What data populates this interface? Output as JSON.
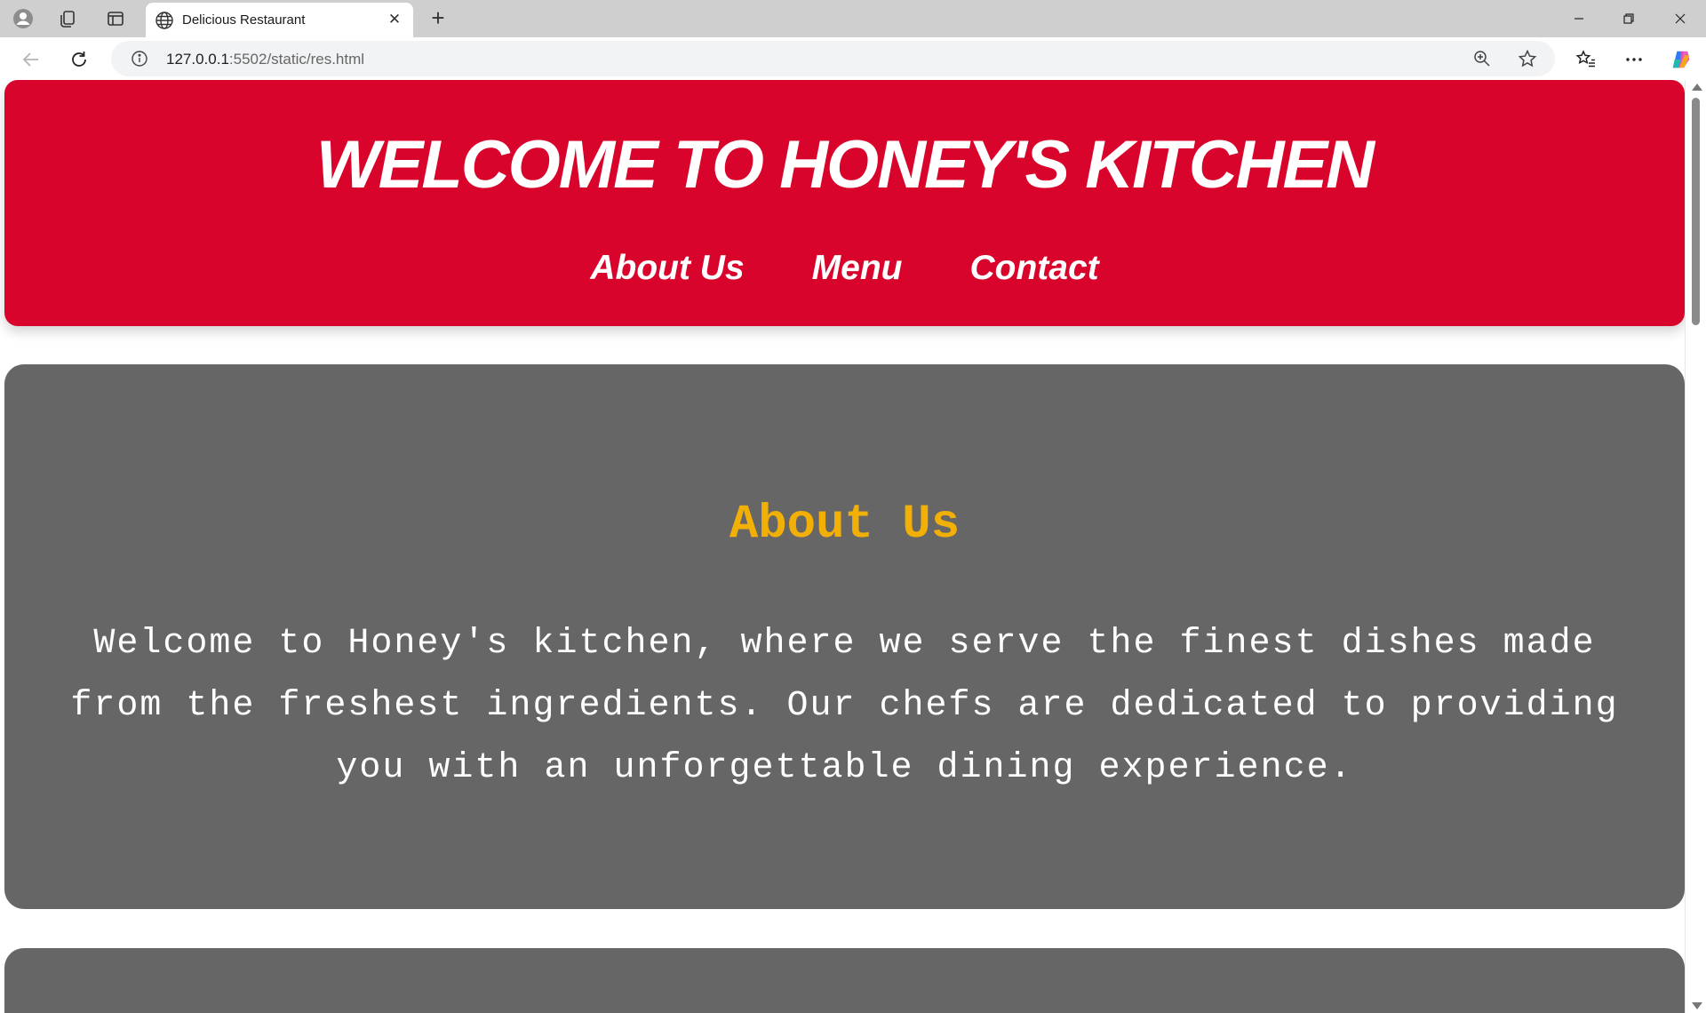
{
  "browser": {
    "tab": {
      "title": "Delicious Restaurant"
    },
    "url": {
      "host": "127.0.0.1",
      "rest": ":5502/static/res.html"
    }
  },
  "page": {
    "header": {
      "title": "WELCOME TO HONEY'S KITCHEN",
      "nav": [
        "About Us",
        "Menu",
        "Contact"
      ]
    },
    "about": {
      "heading": "About Us",
      "text": "Welcome to Honey's kitchen, where we serve the finest dishes made from the freshest ingredients. Our chefs are dedicated to providing you with an unforgettable dining experience."
    }
  },
  "colors": {
    "header_bg": "#d9042b",
    "section_bg": "#666666",
    "heading_accent": "#f2b007",
    "text": "#ffffff"
  }
}
